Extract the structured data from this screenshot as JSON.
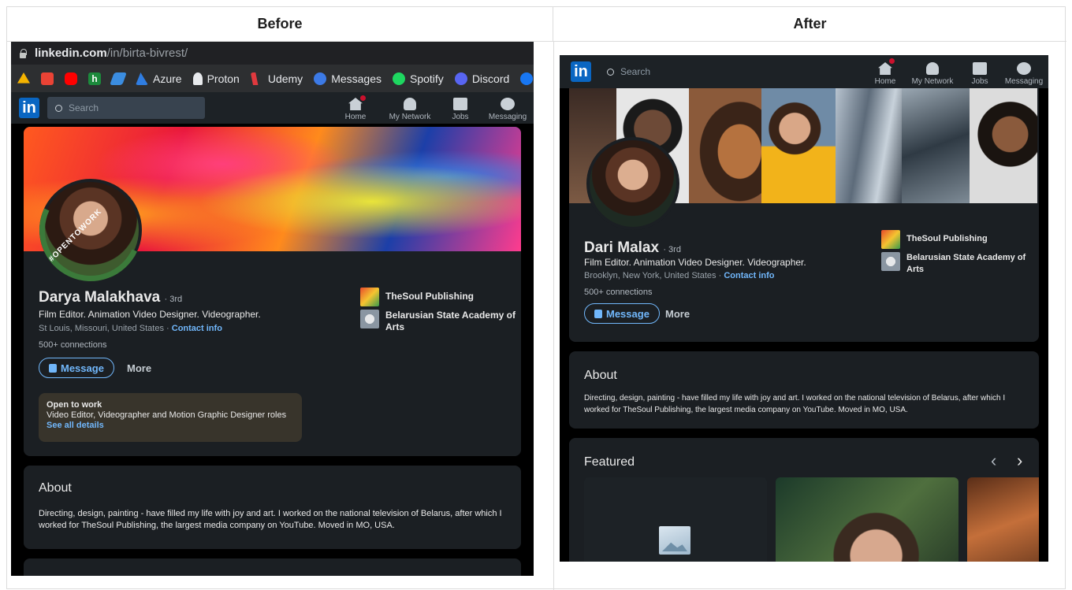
{
  "labels": {
    "before": "Before",
    "after": "After"
  },
  "browser": {
    "url_host": "linkedin.com",
    "url_path": "/in/birta-bivrest/",
    "bookmarks": [
      {
        "label": "",
        "color": "#f5b400"
      },
      {
        "label": "",
        "color": "#ea4335"
      },
      {
        "label": "",
        "color": "#ff0000"
      },
      {
        "label": "h",
        "color": "#1c8a3c"
      },
      {
        "label": "",
        "color": "#3b8de0"
      },
      {
        "label": "Azure",
        "color": "#2f7de1"
      },
      {
        "label": "Proton",
        "color": "#ffffff"
      },
      {
        "label": "Udemy",
        "color": "#a435f0"
      },
      {
        "label": "Messages",
        "color": "#3c7ae6"
      },
      {
        "label": "Spotify",
        "color": "#1ed760"
      },
      {
        "label": "Discord",
        "color": "#5865f2"
      }
    ]
  },
  "nav": {
    "logo": "in",
    "search_placeholder": "Search",
    "items": [
      {
        "label": "Home",
        "icon": "home-icon"
      },
      {
        "label": "My Network",
        "icon": "network-icon"
      },
      {
        "label": "Jobs",
        "icon": "jobs-icon"
      },
      {
        "label": "Messaging",
        "icon": "messaging-icon"
      }
    ]
  },
  "before": {
    "name": "Darya Malakhava",
    "degree": "· 3rd",
    "headline": "Film Editor. Animation Video Designer. Videographer.",
    "location": "St Louis, Missouri, United States ·",
    "contact": "Contact info",
    "connections": "500+ connections",
    "message_btn": "Message",
    "more_btn": "More",
    "orgs": [
      "TheSoul Publishing",
      "Belarusian State Academy of Arts"
    ],
    "open_to_work": {
      "title": "Open to work",
      "roles": "Video Editor, Videographer and Motion Graphic Designer roles",
      "link": "See all details"
    },
    "otw_badge": "#OPENTOWORK",
    "about_title": "About",
    "about_text": "Directing, design, painting - have filled my life with joy and art. I worked on the national television of Belarus, after which I worked for TheSoul Publishing, the largest media company on YouTube. Moved in MO, USA."
  },
  "after": {
    "name": "Dari Malax",
    "degree": "· 3rd",
    "headline": "Film Editor. Animation Video Designer. Videographer.",
    "location": "Brooklyn, New York, United States ·",
    "contact": "Contact info",
    "connections": "500+ connections",
    "message_btn": "Message",
    "more_btn": "More",
    "orgs": [
      "TheSoul Publishing",
      "Belarusian State Academy of Arts"
    ],
    "about_title": "About",
    "about_text": "Directing, design, painting - have filled my life with joy and art. I worked on the national television of Belarus, after which I worked for TheSoul Publishing, the largest media company on YouTube. Moved in MO, USA.",
    "featured_title": "Featured",
    "prev": "‹",
    "next": "›"
  }
}
